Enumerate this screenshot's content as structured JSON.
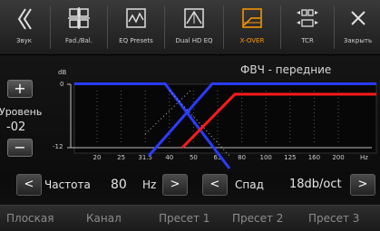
{
  "tabs": [
    {
      "label": "Звук",
      "icon": "chevron-left-icon",
      "active": false
    },
    {
      "label": "Fad./Bal.",
      "icon": "fader-balance-icon",
      "active": false
    },
    {
      "label": "EQ Presets",
      "icon": "eq-presets-icon",
      "active": false
    },
    {
      "label": "Dual HD EQ",
      "icon": "dual-hd-eq-icon",
      "active": false
    },
    {
      "label": "X-OVER",
      "icon": "crossover-icon",
      "active": true
    },
    {
      "label": "TCR",
      "icon": "tcr-icon",
      "active": false
    },
    {
      "label": "Закрыть",
      "icon": "close-icon",
      "active": false
    }
  ],
  "plot": {
    "title": "ФВЧ - передние",
    "db_unit": "dB",
    "db_top": "0",
    "db_bottom": "-12",
    "hz_unit": "Hz",
    "freq_ticks": [
      "20",
      "25",
      "31.5",
      "40",
      "50",
      "63",
      "80",
      "100",
      "125",
      "160",
      "200"
    ]
  },
  "level": {
    "plus": "+",
    "label": "Уровень",
    "value": "-02",
    "minus": "−"
  },
  "controls": {
    "freq_label": "Частота",
    "freq_value": "80",
    "freq_unit": "Hz",
    "slope_label": "Спад",
    "slope_value": "18db/oct",
    "prev": "<",
    "next": ">"
  },
  "presets": [
    "Плоская",
    "Канал",
    "Пресет 1",
    "Пресет 2",
    "Пресет 3"
  ],
  "colors": {
    "active": "#ff9a00",
    "lowpass_curve": "#2a3cff",
    "highpass_curve": "#ff1a1a"
  }
}
